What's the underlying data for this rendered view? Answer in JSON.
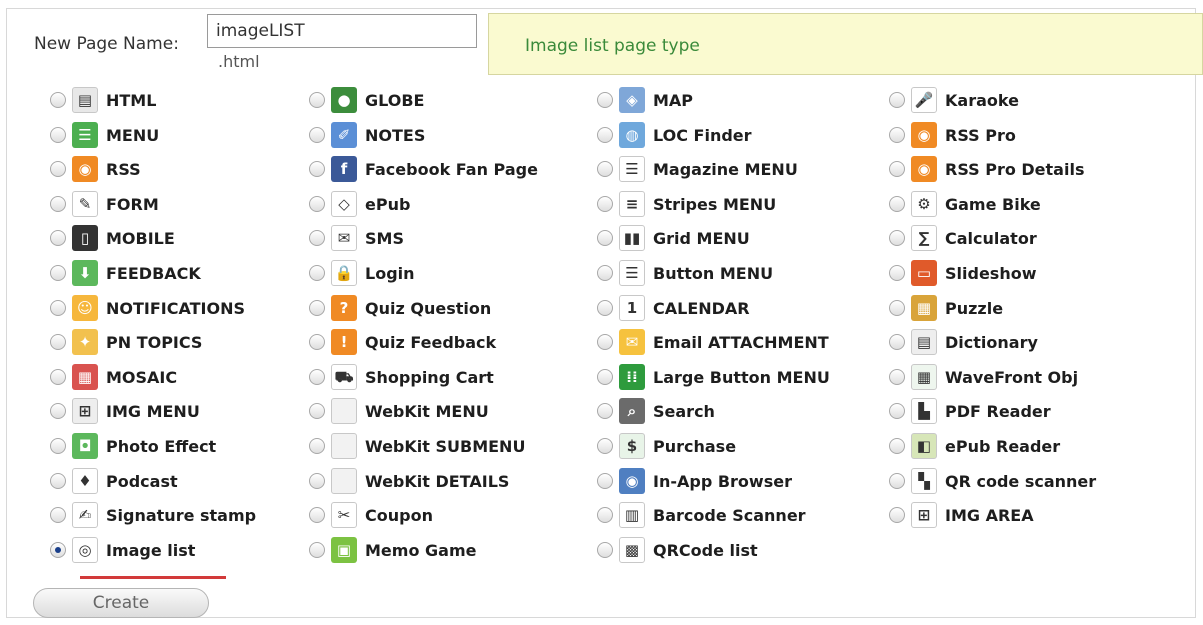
{
  "form": {
    "name_label": "New Page Name:",
    "name_value": "imageLIST",
    "extension": ".html",
    "description": "Image list page type",
    "create_label": "Create",
    "selected": "Image list"
  },
  "columns": [
    [
      {
        "label": "HTML",
        "icon": "html-page-icon",
        "color": "#e8e8e8",
        "glyph": "▤"
      },
      {
        "label": "MENU",
        "icon": "menu-icon",
        "color": "#4caf50",
        "glyph": "☰"
      },
      {
        "label": "RSS",
        "icon": "rss-icon",
        "color": "#f08a24",
        "glyph": "◉"
      },
      {
        "label": "FORM",
        "icon": "pencil-icon",
        "color": "#ffffff",
        "glyph": "✎"
      },
      {
        "label": "MOBILE",
        "icon": "mobile-phone-icon",
        "color": "#333333",
        "glyph": "▯"
      },
      {
        "label": "FEEDBACK",
        "icon": "feedback-download-icon",
        "color": "#5cb85c",
        "glyph": "⬇"
      },
      {
        "label": "NOTIFICATIONS",
        "icon": "notification-smiley-icon",
        "color": "#f6b73c",
        "glyph": "☺"
      },
      {
        "label": "PN TOPICS",
        "icon": "pn-topics-icon",
        "color": "#f2c14e",
        "glyph": "✦"
      },
      {
        "label": "MOSAIC",
        "icon": "mosaic-icon",
        "color": "#d9534f",
        "glyph": "▦"
      },
      {
        "label": "IMG MENU",
        "icon": "image-grid-icon",
        "color": "#eeeeee",
        "glyph": "⊞"
      },
      {
        "label": "Photo Effect",
        "icon": "camera-icon",
        "color": "#5cb85c",
        "glyph": "◘"
      },
      {
        "label": "Podcast",
        "icon": "podcast-icon",
        "color": "#ffffff",
        "glyph": "♦"
      },
      {
        "label": "Signature stamp",
        "icon": "signature-stamp-icon",
        "color": "#ffffff",
        "glyph": "✍"
      },
      {
        "label": "Image list",
        "icon": "image-list-icon",
        "color": "#ffffff",
        "glyph": "◎"
      }
    ],
    [
      {
        "label": "GLOBE",
        "icon": "globe-icon",
        "color": "#3c8d3c",
        "glyph": "●"
      },
      {
        "label": "NOTES",
        "icon": "notes-icon",
        "color": "#5b8fd6",
        "glyph": "✐"
      },
      {
        "label": "Facebook Fan Page",
        "icon": "facebook-icon",
        "color": "#3b5998",
        "glyph": "f"
      },
      {
        "label": "ePub",
        "icon": "epub-icon",
        "color": "#ffffff",
        "glyph": "◇"
      },
      {
        "label": "SMS",
        "icon": "envelope-icon",
        "color": "#ffffff",
        "glyph": "✉"
      },
      {
        "label": "Login",
        "icon": "lock-icon",
        "color": "#ffffff",
        "glyph": "🔒"
      },
      {
        "label": "Quiz Question",
        "icon": "quiz-question-icon",
        "color": "#f08a24",
        "glyph": "?"
      },
      {
        "label": "Quiz Feedback",
        "icon": "quiz-feedback-icon",
        "color": "#f08a24",
        "glyph": "!"
      },
      {
        "label": "Shopping Cart",
        "icon": "shopping-cart-icon",
        "color": "#ffffff",
        "glyph": "⛟"
      },
      {
        "label": "WebKit MENU",
        "icon": "webkit-menu-icon",
        "color": "#f2f2f2",
        "glyph": ""
      },
      {
        "label": "WebKit SUBMENU",
        "icon": "webkit-submenu-icon",
        "color": "#f2f2f2",
        "glyph": ""
      },
      {
        "label": "WebKit DETAILS",
        "icon": "webkit-details-icon",
        "color": "#f2f2f2",
        "glyph": ""
      },
      {
        "label": "Coupon",
        "icon": "coupon-scissors-icon",
        "color": "#ffffff",
        "glyph": "✂"
      },
      {
        "label": "Memo Game",
        "icon": "memo-game-icon",
        "color": "#7cc242",
        "glyph": "▣"
      }
    ],
    [
      {
        "label": "MAP",
        "icon": "map-icon",
        "color": "#7fa7d8",
        "glyph": "◈"
      },
      {
        "label": "LOC Finder",
        "icon": "location-finder-icon",
        "color": "#6fa8dc",
        "glyph": "◍"
      },
      {
        "label": "Magazine MENU",
        "icon": "magazine-menu-icon",
        "color": "#ffffff",
        "glyph": "☰"
      },
      {
        "label": "Stripes MENU",
        "icon": "stripes-menu-icon",
        "color": "#ffffff",
        "glyph": "≡"
      },
      {
        "label": "Grid MENU",
        "icon": "grid-menu-icon",
        "color": "#ffffff",
        "glyph": "▮▮"
      },
      {
        "label": "Button MENU",
        "icon": "button-menu-icon",
        "color": "#ffffff",
        "glyph": "☰"
      },
      {
        "label": "CALENDAR",
        "icon": "calendar-icon",
        "color": "#ffffff",
        "glyph": "1"
      },
      {
        "label": "Email ATTACHMENT",
        "icon": "email-attachment-icon",
        "color": "#f6c23e",
        "glyph": "✉"
      },
      {
        "label": "Large Button MENU",
        "icon": "large-button-grid-icon",
        "color": "#2e9b3d",
        "glyph": "⁞⁞"
      },
      {
        "label": "Search",
        "icon": "search-icon",
        "color": "#6b6b6b",
        "glyph": "⌕"
      },
      {
        "label": "Purchase",
        "icon": "dollar-icon",
        "color": "#e8f4e8",
        "glyph": "$"
      },
      {
        "label": "In-App Browser",
        "icon": "browser-globe-icon",
        "color": "#4f7fc1",
        "glyph": "◉"
      },
      {
        "label": "Barcode Scanner",
        "icon": "barcode-icon",
        "color": "#ffffff",
        "glyph": "▥"
      },
      {
        "label": "QRCode list",
        "icon": "qrcode-icon",
        "color": "#ffffff",
        "glyph": "▩"
      }
    ],
    [
      {
        "label": "Karaoke",
        "icon": "microphone-icon",
        "color": "#ffffff",
        "glyph": "🎤"
      },
      {
        "label": "RSS Pro",
        "icon": "rss-pro-icon",
        "color": "#f08a24",
        "glyph": "◉"
      },
      {
        "label": "RSS Pro Details",
        "icon": "rss-pro-details-icon",
        "color": "#f08a24",
        "glyph": "◉"
      },
      {
        "label": "Game Bike",
        "icon": "game-bike-icon",
        "color": "#ffffff",
        "glyph": "⚙"
      },
      {
        "label": "Calculator",
        "icon": "sigma-icon",
        "color": "#ffffff",
        "glyph": "∑"
      },
      {
        "label": "Slideshow",
        "icon": "slideshow-icon",
        "color": "#e05a2a",
        "glyph": "▭"
      },
      {
        "label": "Puzzle",
        "icon": "puzzle-icon",
        "color": "#d9a43a",
        "glyph": "▦"
      },
      {
        "label": "Dictionary",
        "icon": "dictionary-icon",
        "color": "#eeeeee",
        "glyph": "▤"
      },
      {
        "label": "WaveFront Obj",
        "icon": "wavefront-icon",
        "color": "#eef6ee",
        "glyph": "▦"
      },
      {
        "label": "PDF Reader",
        "icon": "pdf-icon",
        "color": "#ffffff",
        "glyph": "▙"
      },
      {
        "label": "ePub Reader",
        "icon": "epub-reader-icon",
        "color": "#d7e6b8",
        "glyph": "◧"
      },
      {
        "label": "QR code scanner",
        "icon": "qr-scanner-icon",
        "color": "#ffffff",
        "glyph": "▚"
      },
      {
        "label": "IMG AREA",
        "icon": "image-area-icon",
        "color": "#ffffff",
        "glyph": "⊞"
      }
    ]
  ]
}
